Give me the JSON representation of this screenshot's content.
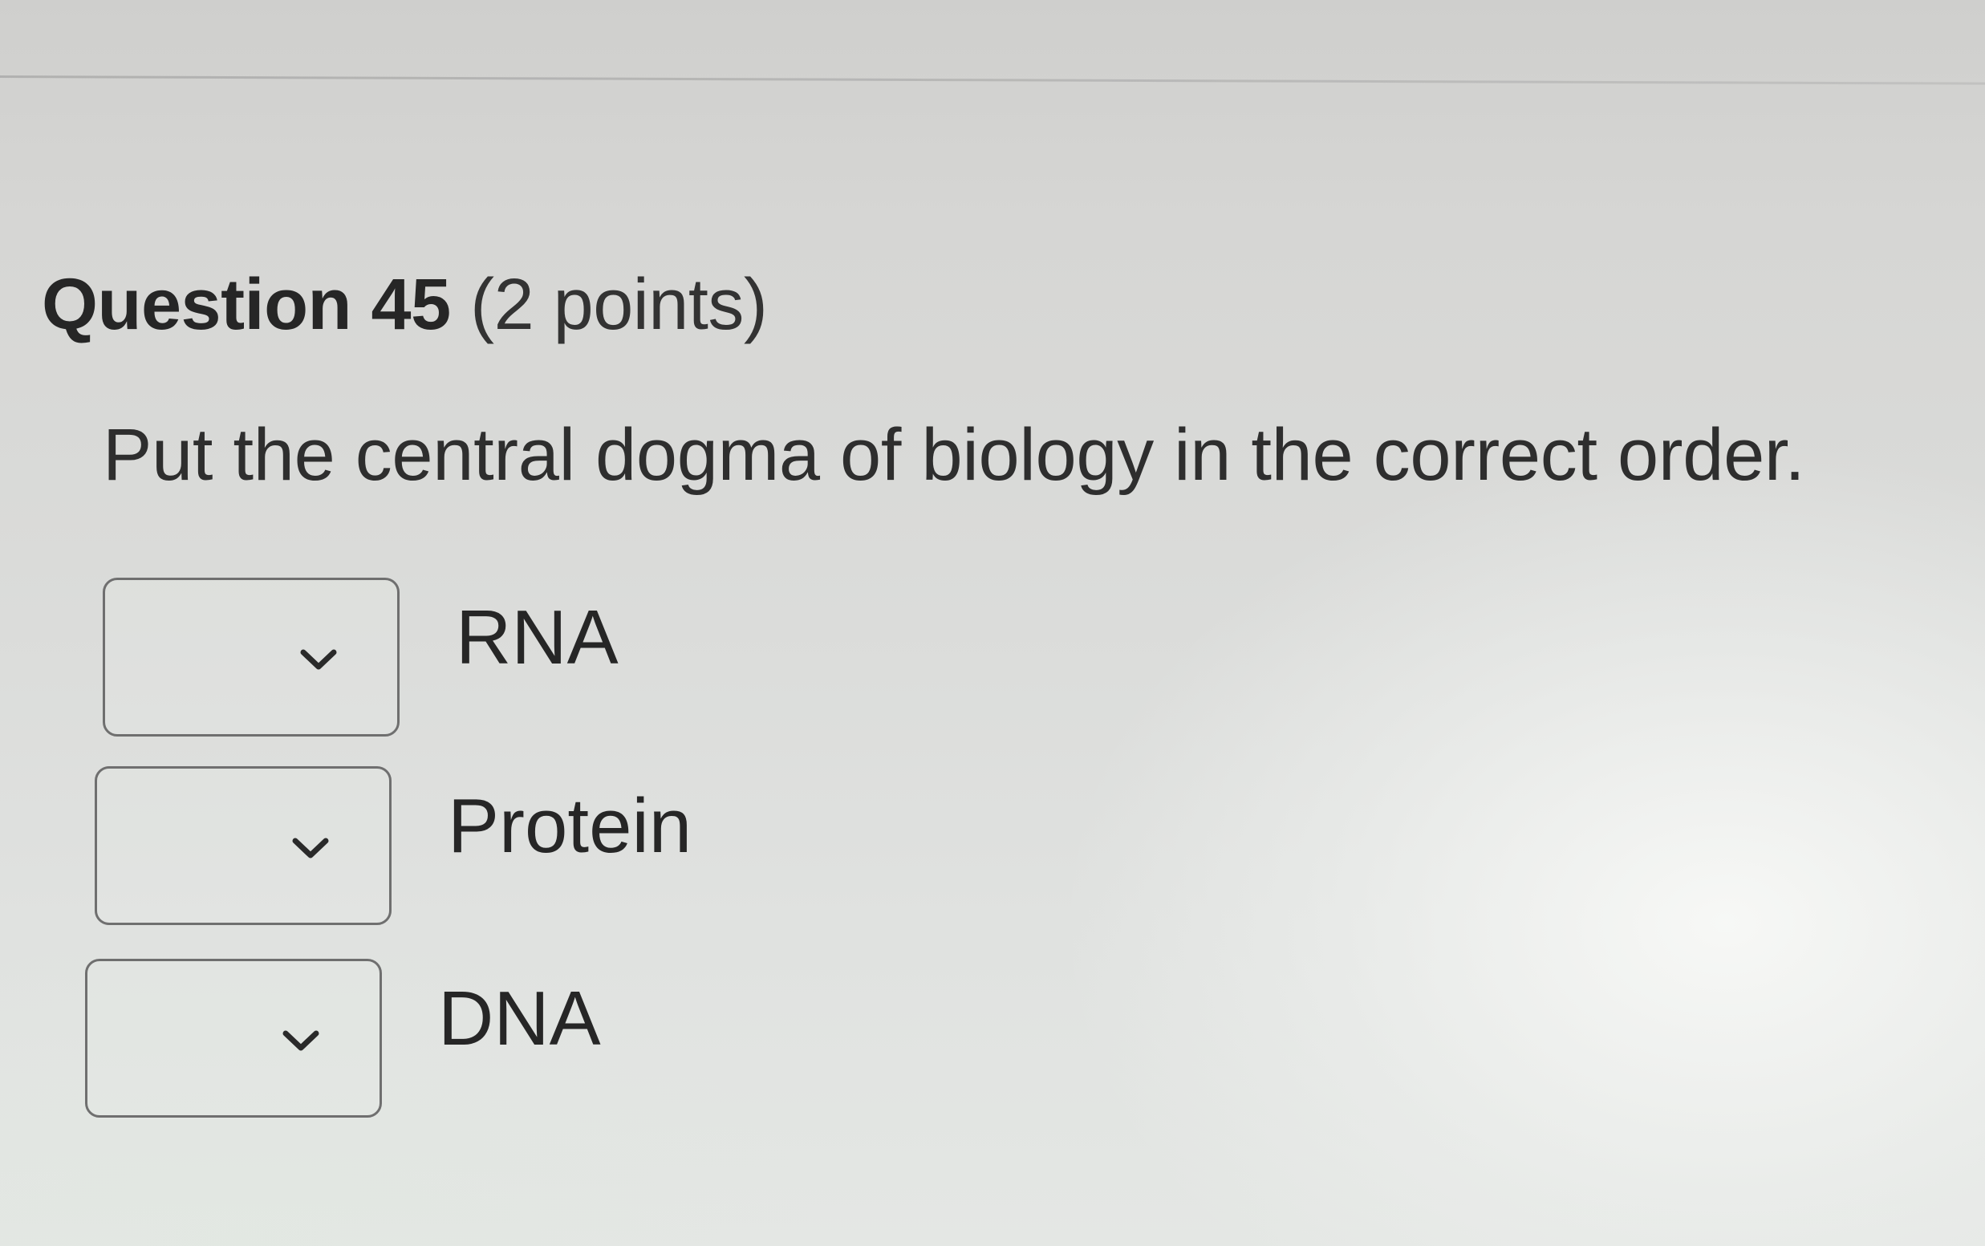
{
  "question": {
    "title": "Question 45",
    "points": "(2 points)",
    "prompt": "Put the central dogma of biology in the correct order."
  },
  "order_items": [
    {
      "label": "RNA",
      "selected_value": "",
      "icon": "chevron-down-icon"
    },
    {
      "label": "Protein",
      "selected_value": "",
      "icon": "chevron-down-icon"
    },
    {
      "label": "DNA",
      "selected_value": "",
      "icon": "chevron-down-icon"
    }
  ],
  "colors": {
    "text": "#2b2b2b",
    "select_border": "#6f6f6f",
    "background": "#dadbd9"
  }
}
